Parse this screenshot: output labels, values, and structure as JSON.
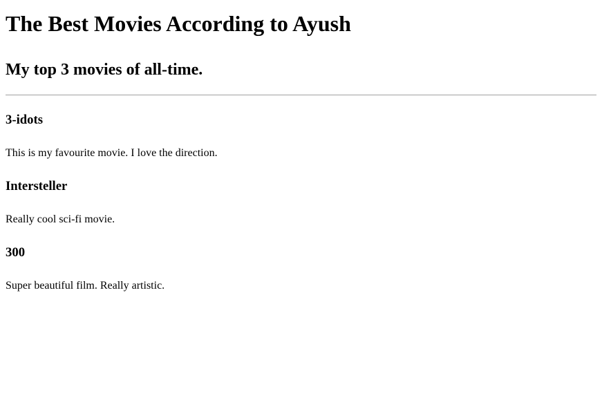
{
  "title": "The Best Movies According to Ayush",
  "subtitle": "My top 3 movies of all-time.",
  "movies": [
    {
      "name": "3-idots",
      "description": "This is my favourite movie. I love the direction."
    },
    {
      "name": "Intersteller",
      "description": "Really cool sci-fi movie."
    },
    {
      "name": "300",
      "description": "Super beautiful film. Really artistic."
    }
  ]
}
